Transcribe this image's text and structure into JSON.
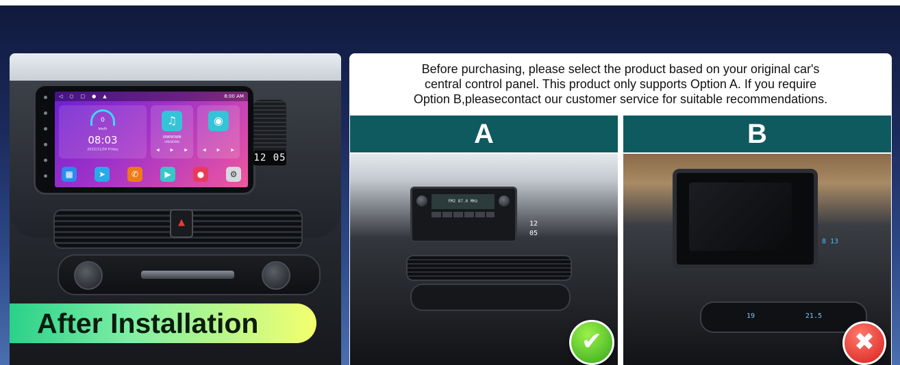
{
  "left_panel": {
    "badge": "After Installation",
    "head_unit": {
      "status_time": "8:00 AM",
      "speed_value": "0",
      "speed_unit": "km/h",
      "clock_time": "08:03",
      "clock_date": "2022/11/04  Friday",
      "music_label": "UNKNOWN",
      "music_sub": "UNKNOWN",
      "dash_clock": "12 05"
    }
  },
  "right_panel": {
    "notice_lines": [
      "Before purchasing, please select the product based on your original car's",
      "central control panel. This product only supports Option A. If you require",
      "Option B,pleasecontact our customer service for suitable recommendations."
    ],
    "option_a": {
      "label": "A",
      "radio_display": "FM2  87.6 MHz",
      "clock": "12 05",
      "status": "supported"
    },
    "option_b": {
      "label": "B",
      "clock": "8 13",
      "temp_left": "19",
      "temp_right": "21.5",
      "status": "not-supported"
    }
  },
  "icons": {
    "check": "check-icon",
    "cross": "cross-icon",
    "hazard": "hazard-icon"
  },
  "colors": {
    "header_band": "#0f5a5e",
    "badge_start": "#2ad18a",
    "badge_end": "#f4ff6e",
    "check": "#35a71c",
    "cross": "#d81f1f"
  }
}
